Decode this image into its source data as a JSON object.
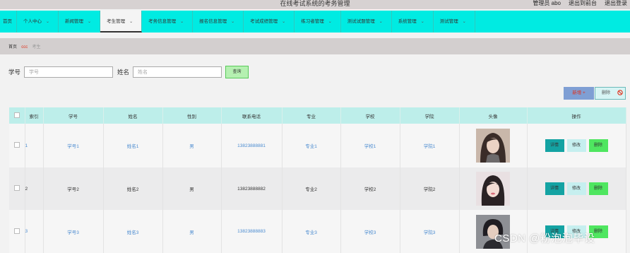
{
  "header": {
    "title": "在线考试系统的考务管理",
    "user": "管理员 abo",
    "front_link": "退出到前台",
    "logout": "退出登录"
  },
  "nav": {
    "home": "首页",
    "items": [
      "个人中心",
      "新闻管理",
      "考生管理",
      "考务信息管理",
      "报名信息管理",
      "考试成绩管理",
      "练习者管理",
      "测试试题管理",
      "系统管理",
      "测试管理"
    ]
  },
  "breadcrumb": {
    "home": "首页",
    "separator": "ccc",
    "current": "考生"
  },
  "search": {
    "id_label": "学号",
    "id_placeholder": "学号",
    "name_label": "姓名",
    "name_placeholder": "姓名",
    "query_button": "查询"
  },
  "actions": {
    "add": "新增",
    "delete": "删除"
  },
  "table": {
    "headers": [
      "索引",
      "学号",
      "姓名",
      "性别",
      "联系电话",
      "专业",
      "学校",
      "学院",
      "头像",
      "操作"
    ],
    "rows": [
      {
        "index": "1",
        "id": "学号1",
        "name": "姓名1",
        "gender": "男",
        "phone": "13823888881",
        "major": "专业1",
        "school": "学校1",
        "college": "学院1"
      },
      {
        "index": "2",
        "id": "学号2",
        "name": "姓名2",
        "gender": "男",
        "phone": "13823888882",
        "major": "专业2",
        "school": "学校2",
        "college": "学院2"
      },
      {
        "index": "3",
        "id": "学号3",
        "name": "姓名3",
        "gender": "男",
        "phone": "13823888883",
        "major": "专业3",
        "school": "学校3",
        "college": "学院3"
      }
    ],
    "row_actions": {
      "detail": "详情",
      "edit": "修改",
      "delete": "删除"
    }
  },
  "watermark": "CSDN @粉泡泡毕设",
  "colors": {
    "nav_bg": "#00ebe2",
    "header_bg": "#d7d2d2",
    "table_header_bg": "#bdeeea",
    "detail_btn": "#14a3a3",
    "edit_btn": "#c6efef",
    "delete_btn": "#4fe660",
    "query_btn": "#b5f0b1",
    "add_btn": "#7f9fd4"
  }
}
